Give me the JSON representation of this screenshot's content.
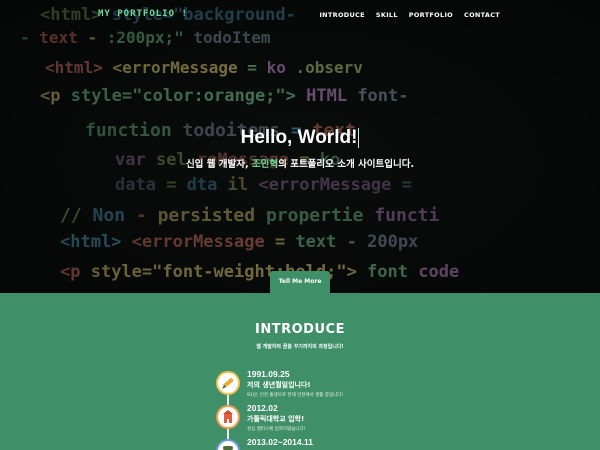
{
  "nav": {
    "logo": "MY PORTFOLIO !",
    "menu": [
      "INTRODUCE",
      "SKILL",
      "PORTFOLIO",
      "CONTACT"
    ]
  },
  "hero": {
    "title": "Hello, World!",
    "subtitle_pre": "신입 웹 개발자, ",
    "subtitle_name": "조민혁",
    "subtitle_post": "의 포트폴리오 소개 사이트입니다.",
    "button": "Tell Me More",
    "code_lines": [
      "<html> style=\"background-",
      "- text - :200px;\"  todoItem",
      "<html> <errorMessage = ko  .observ",
      "<p style=\"color:orange;\"> HTML font-",
      "function  todoitems  = text",
      "var  sel  reMessage = ko",
      "data = dta  il  <errorMessage =",
      "// Non - persisted propertie functi",
      "<html> <errorMessage = text - 200px",
      "<p style=\"font-weight:bold;\"> font code"
    ]
  },
  "intro": {
    "title": "INTRODUCE",
    "subtitle": "웹 개발자의 꿈을 꾸기까지의 과정입니다!",
    "timeline": [
      {
        "date": "1991.09.25",
        "title": "저의 생년월일입니다!",
        "desc": "91년, 인천 출생으로 현재 인천에서 생활 중입니다!",
        "icon": "pencil-icon",
        "color": "#f3c24f"
      },
      {
        "date": "2012.02",
        "title": "가톨릭대학교 입학!",
        "desc": "성심 캠퍼스에 입학하였습니다!",
        "icon": "building-icon",
        "color": "#f39a4f"
      },
      {
        "date": "2013.02~2014.11",
        "title": "",
        "desc": "",
        "icon": "soldier-icon",
        "color": "#6a9ad8"
      }
    ]
  }
}
